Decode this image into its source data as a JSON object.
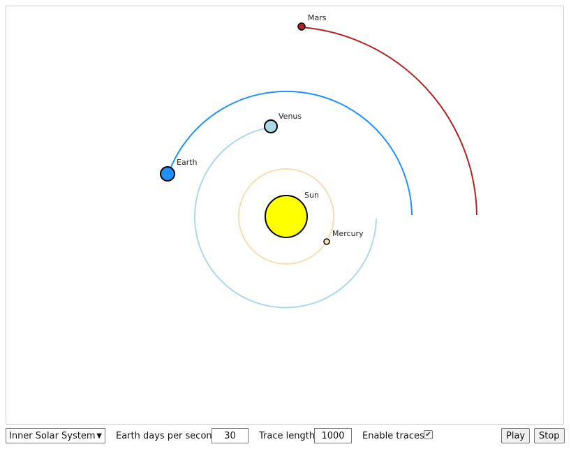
{
  "simulation": {
    "sun": {
      "label": "Sun",
      "color": "#ffff00"
    },
    "planets": [
      {
        "id": "mercury",
        "label": "Mercury",
        "color": "#ffe4b5",
        "orbit_color": "#f5deb3"
      },
      {
        "id": "venus",
        "label": "Venus",
        "color": "#add8e6",
        "orbit_color": "#add8e6"
      },
      {
        "id": "earth",
        "label": "Earth",
        "color": "#1e90ff",
        "orbit_color": "#1e90ff"
      },
      {
        "id": "mars",
        "label": "Mars",
        "color": "#b22222",
        "orbit_color": "#b22222"
      }
    ]
  },
  "controls": {
    "system_select": {
      "value": "Inner Solar System",
      "arrow_icon": "triangle-down-icon"
    },
    "days_per_second": {
      "label": "Earth days per second",
      "value": "30"
    },
    "trace_length": {
      "label": "Trace length",
      "value": "1000"
    },
    "enable_traces": {
      "label": "Enable traces",
      "checked": true
    },
    "play_label": "Play",
    "stop_label": "Stop"
  }
}
